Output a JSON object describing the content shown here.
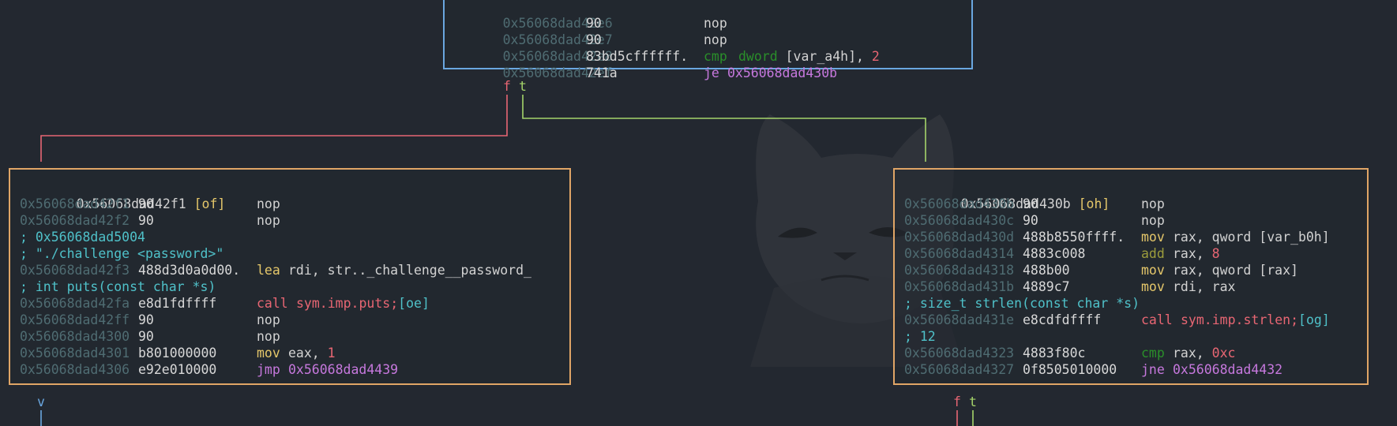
{
  "colors": {
    "background": "#232830",
    "block_border_orange": "#e0a566",
    "block_border_blue": "#6aa7e0",
    "edge_false": "#e86673",
    "edge_true": "#a5d46a",
    "edge_unconditional": "#6aa7e0"
  },
  "top_block": {
    "lines": [
      {
        "addr": "0x56068dad42e6",
        "hex": "90",
        "mn": "nop",
        "op": ""
      },
      {
        "addr": "0x56068dad42e7",
        "hex": "90",
        "mn": "nop",
        "op": ""
      },
      {
        "addr": "0x56068dad42e8",
        "hex": "83bd5cffffff.",
        "mn": "cmp",
        "op_a": "dword",
        "op_b": " [var_a4h], ",
        "op_c": "2"
      },
      {
        "addr": "0x56068dad42ef",
        "hex": "741a",
        "mn": "je",
        "op": "0x56068dad430b"
      }
    ]
  },
  "edges": {
    "false_label": "f",
    "true_label": "t",
    "v_label": "v"
  },
  "left_block": {
    "title_addr": "0x56068dad42f1",
    "title_tag": "[of]",
    "lines": [
      {
        "addr": "0x56068dad42f1",
        "hex": "90",
        "mn": "nop",
        "op": ""
      },
      {
        "addr": "0x56068dad42f2",
        "hex": "90",
        "mn": "nop",
        "op": ""
      },
      {
        "comment": "; 0x56068dad5004"
      },
      {
        "comment": "; \"./challenge <password>\""
      },
      {
        "addr": "0x56068dad42f3",
        "hex": "488d3d0a0d00.",
        "mn": "lea",
        "op": "rdi, str.._challenge__password_"
      },
      {
        "comment": "; int puts(const char *s)"
      },
      {
        "addr": "0x56068dad42fa",
        "hex": "e8d1fdffff",
        "mn": "call",
        "op": "sym.imp.puts;",
        "ref": "[oe]"
      },
      {
        "addr": "0x56068dad42ff",
        "hex": "90",
        "mn": "nop",
        "op": ""
      },
      {
        "addr": "0x56068dad4300",
        "hex": "90",
        "mn": "nop",
        "op": ""
      },
      {
        "addr": "0x56068dad4301",
        "hex": "b801000000",
        "mn": "mov",
        "op_a": "eax, ",
        "op_c": "1"
      },
      {
        "addr": "0x56068dad4306",
        "hex": "e92e010000",
        "mn": "jmp",
        "op": "0x56068dad4439"
      }
    ]
  },
  "right_block": {
    "title_addr": "0x56068dad430b",
    "title_tag": "[oh]",
    "lines": [
      {
        "addr": "0x56068dad430b",
        "hex": "90",
        "mn": "nop",
        "op": ""
      },
      {
        "addr": "0x56068dad430c",
        "hex": "90",
        "mn": "nop",
        "op": ""
      },
      {
        "addr": "0x56068dad430d",
        "hex": "488b8550ffff.",
        "mn": "mov",
        "op": "rax, qword [var_b0h]"
      },
      {
        "addr": "0x56068dad4314",
        "hex": "4883c008",
        "mn": "add",
        "op_a": "rax, ",
        "op_c": "8"
      },
      {
        "addr": "0x56068dad4318",
        "hex": "488b00",
        "mn": "mov",
        "op": "rax, qword [rax]"
      },
      {
        "addr": "0x56068dad431b",
        "hex": "4889c7",
        "mn": "mov",
        "op": "rdi, rax"
      },
      {
        "comment": "; size_t strlen(const char *s)"
      },
      {
        "addr": "0x56068dad431e",
        "hex": "e8cdfdffff",
        "mn": "call",
        "op": "sym.imp.strlen;",
        "ref": "[og]"
      },
      {
        "comment": "; 12"
      },
      {
        "addr": "0x56068dad4323",
        "hex": "4883f80c",
        "mn": "cmp",
        "op_a": "rax, ",
        "op_c": "0xc"
      },
      {
        "addr": "0x56068dad4327",
        "hex": "0f8505010000",
        "mn": "jne",
        "op": "0x56068dad4432"
      }
    ]
  }
}
